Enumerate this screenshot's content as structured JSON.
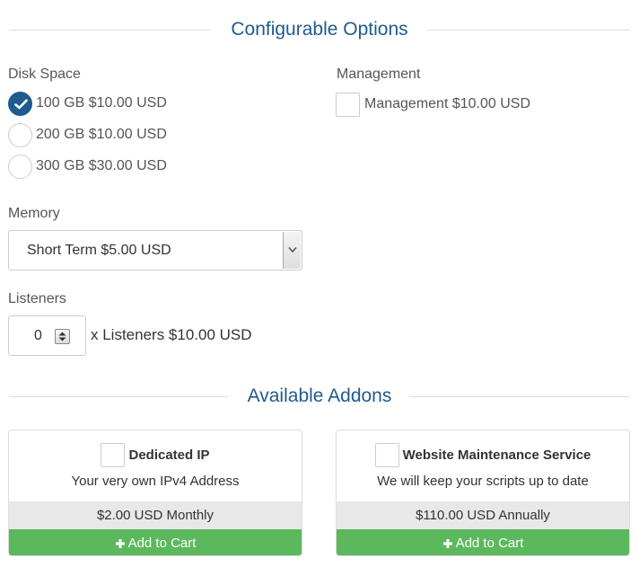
{
  "configurable_options": {
    "heading": "Configurable Options",
    "disk_space": {
      "label": "Disk Space",
      "options": [
        {
          "label": "100 GB $10.00 USD",
          "selected": true
        },
        {
          "label": "200 GB $10.00 USD",
          "selected": false
        },
        {
          "label": "300 GB $30.00 USD",
          "selected": false
        }
      ]
    },
    "management": {
      "label": "Management",
      "option_label": "Management $10.00 USD",
      "checked": false
    },
    "memory": {
      "label": "Memory",
      "selected_value": "Short Term $5.00 USD"
    },
    "listeners": {
      "label": "Listeners",
      "quantity": "0",
      "suffix": "x Listeners $10.00 USD"
    }
  },
  "addons": {
    "heading": "Available Addons",
    "items": [
      {
        "name": "Dedicated IP",
        "description": "Your very own IPv4 Address",
        "price": "$2.00 USD Monthly",
        "cta": "Add to Cart",
        "checked": false
      },
      {
        "name": "Website Maintenance Service",
        "description": "We will keep your scripts up to date",
        "price": "$110.00 USD Annually",
        "cta": "Add to Cart",
        "checked": false
      }
    ]
  },
  "colors": {
    "heading": "#1f5b8f",
    "radio_checked": "#1f5b8f",
    "add_to_cart": "#5cb85c",
    "price_bar": "#e8e8e8"
  },
  "icons": {
    "radio_checked": "check-icon",
    "select_arrow": "chevron-down-icon",
    "stepper": "up-down-arrows-icon",
    "cart": "plus-icon"
  }
}
